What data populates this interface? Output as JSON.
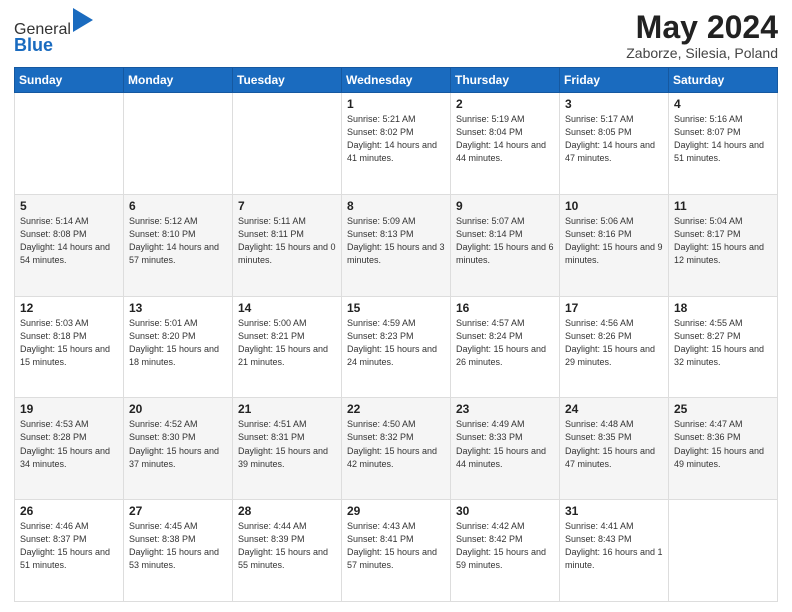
{
  "header": {
    "logo_line1": "General",
    "logo_line2": "Blue",
    "month_title": "May 2024",
    "location": "Zaborze, Silesia, Poland"
  },
  "days_of_week": [
    "Sunday",
    "Monday",
    "Tuesday",
    "Wednesday",
    "Thursday",
    "Friday",
    "Saturday"
  ],
  "weeks": [
    [
      {
        "day": "",
        "info": ""
      },
      {
        "day": "",
        "info": ""
      },
      {
        "day": "",
        "info": ""
      },
      {
        "day": "1",
        "info": "Sunrise: 5:21 AM\nSunset: 8:02 PM\nDaylight: 14 hours and 41 minutes."
      },
      {
        "day": "2",
        "info": "Sunrise: 5:19 AM\nSunset: 8:04 PM\nDaylight: 14 hours and 44 minutes."
      },
      {
        "day": "3",
        "info": "Sunrise: 5:17 AM\nSunset: 8:05 PM\nDaylight: 14 hours and 47 minutes."
      },
      {
        "day": "4",
        "info": "Sunrise: 5:16 AM\nSunset: 8:07 PM\nDaylight: 14 hours and 51 minutes."
      }
    ],
    [
      {
        "day": "5",
        "info": "Sunrise: 5:14 AM\nSunset: 8:08 PM\nDaylight: 14 hours and 54 minutes."
      },
      {
        "day": "6",
        "info": "Sunrise: 5:12 AM\nSunset: 8:10 PM\nDaylight: 14 hours and 57 minutes."
      },
      {
        "day": "7",
        "info": "Sunrise: 5:11 AM\nSunset: 8:11 PM\nDaylight: 15 hours and 0 minutes."
      },
      {
        "day": "8",
        "info": "Sunrise: 5:09 AM\nSunset: 8:13 PM\nDaylight: 15 hours and 3 minutes."
      },
      {
        "day": "9",
        "info": "Sunrise: 5:07 AM\nSunset: 8:14 PM\nDaylight: 15 hours and 6 minutes."
      },
      {
        "day": "10",
        "info": "Sunrise: 5:06 AM\nSunset: 8:16 PM\nDaylight: 15 hours and 9 minutes."
      },
      {
        "day": "11",
        "info": "Sunrise: 5:04 AM\nSunset: 8:17 PM\nDaylight: 15 hours and 12 minutes."
      }
    ],
    [
      {
        "day": "12",
        "info": "Sunrise: 5:03 AM\nSunset: 8:18 PM\nDaylight: 15 hours and 15 minutes."
      },
      {
        "day": "13",
        "info": "Sunrise: 5:01 AM\nSunset: 8:20 PM\nDaylight: 15 hours and 18 minutes."
      },
      {
        "day": "14",
        "info": "Sunrise: 5:00 AM\nSunset: 8:21 PM\nDaylight: 15 hours and 21 minutes."
      },
      {
        "day": "15",
        "info": "Sunrise: 4:59 AM\nSunset: 8:23 PM\nDaylight: 15 hours and 24 minutes."
      },
      {
        "day": "16",
        "info": "Sunrise: 4:57 AM\nSunset: 8:24 PM\nDaylight: 15 hours and 26 minutes."
      },
      {
        "day": "17",
        "info": "Sunrise: 4:56 AM\nSunset: 8:26 PM\nDaylight: 15 hours and 29 minutes."
      },
      {
        "day": "18",
        "info": "Sunrise: 4:55 AM\nSunset: 8:27 PM\nDaylight: 15 hours and 32 minutes."
      }
    ],
    [
      {
        "day": "19",
        "info": "Sunrise: 4:53 AM\nSunset: 8:28 PM\nDaylight: 15 hours and 34 minutes."
      },
      {
        "day": "20",
        "info": "Sunrise: 4:52 AM\nSunset: 8:30 PM\nDaylight: 15 hours and 37 minutes."
      },
      {
        "day": "21",
        "info": "Sunrise: 4:51 AM\nSunset: 8:31 PM\nDaylight: 15 hours and 39 minutes."
      },
      {
        "day": "22",
        "info": "Sunrise: 4:50 AM\nSunset: 8:32 PM\nDaylight: 15 hours and 42 minutes."
      },
      {
        "day": "23",
        "info": "Sunrise: 4:49 AM\nSunset: 8:33 PM\nDaylight: 15 hours and 44 minutes."
      },
      {
        "day": "24",
        "info": "Sunrise: 4:48 AM\nSunset: 8:35 PM\nDaylight: 15 hours and 47 minutes."
      },
      {
        "day": "25",
        "info": "Sunrise: 4:47 AM\nSunset: 8:36 PM\nDaylight: 15 hours and 49 minutes."
      }
    ],
    [
      {
        "day": "26",
        "info": "Sunrise: 4:46 AM\nSunset: 8:37 PM\nDaylight: 15 hours and 51 minutes."
      },
      {
        "day": "27",
        "info": "Sunrise: 4:45 AM\nSunset: 8:38 PM\nDaylight: 15 hours and 53 minutes."
      },
      {
        "day": "28",
        "info": "Sunrise: 4:44 AM\nSunset: 8:39 PM\nDaylight: 15 hours and 55 minutes."
      },
      {
        "day": "29",
        "info": "Sunrise: 4:43 AM\nSunset: 8:41 PM\nDaylight: 15 hours and 57 minutes."
      },
      {
        "day": "30",
        "info": "Sunrise: 4:42 AM\nSunset: 8:42 PM\nDaylight: 15 hours and 59 minutes."
      },
      {
        "day": "31",
        "info": "Sunrise: 4:41 AM\nSunset: 8:43 PM\nDaylight: 16 hours and 1 minute."
      },
      {
        "day": "",
        "info": ""
      }
    ]
  ]
}
